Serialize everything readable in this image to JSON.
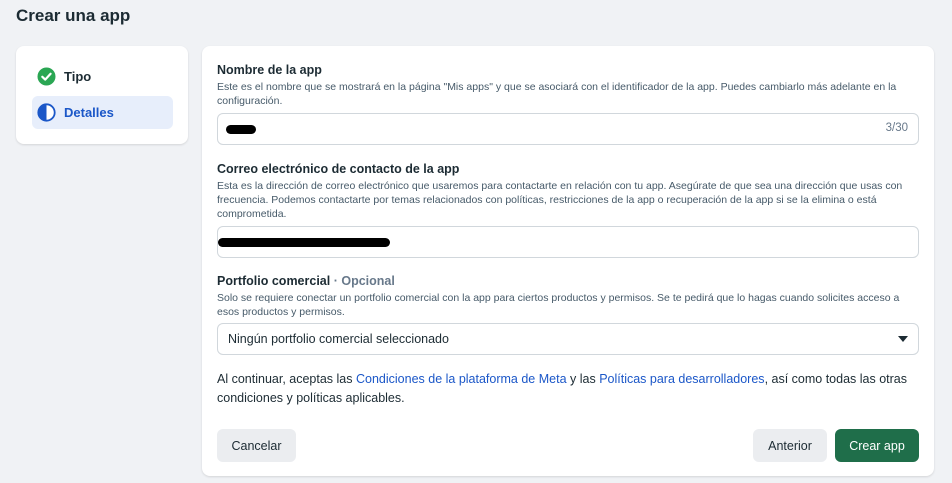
{
  "page": {
    "title": "Crear una app"
  },
  "steps": [
    {
      "label": "Tipo",
      "status": "complete",
      "icon": "check-circle-icon"
    },
    {
      "label": "Detalles",
      "status": "current",
      "icon": "half-circle-icon"
    }
  ],
  "colors": {
    "accent": "#1b57c8",
    "success": "#2aa653",
    "primary_button": "#1f6e4a"
  },
  "form": {
    "app_name": {
      "title": "Nombre de la app",
      "description": "Este es el nombre que se mostrará en la página \"Mis apps\" y que se asociará con el identificador de la app. Puedes cambiarlo más adelante en la configuración.",
      "counter": "3/30"
    },
    "email": {
      "title": "Correo electrónico de contacto de la app",
      "description": "Esta es la dirección de correo electrónico que usaremos para contactarte en relación con tu app. Asegúrate de que sea una dirección que usas con frecuencia. Podemos contactarte por temas relacionados con políticas, restricciones de la app o recuperación de la app si se la elimina o está comprometida."
    },
    "portfolio": {
      "title": "Portfolio comercial",
      "optional": "· Opcional",
      "description": "Solo se requiere conectar un portfolio comercial con la app para ciertos productos y permisos. Se te pedirá que lo hagas cuando solicites acceso a esos productos y permisos.",
      "selected": "Ningún portfolio comercial seleccionado"
    }
  },
  "terms": {
    "prefix": "Al continuar, aceptas las ",
    "link1": "Condiciones de la plataforma de Meta",
    "middle": " y las ",
    "link2": "Políticas para desarrolladores",
    "suffix": ", así como todas las otras condiciones y políticas aplicables."
  },
  "buttons": {
    "cancel": "Cancelar",
    "previous": "Anterior",
    "create": "Crear app"
  }
}
